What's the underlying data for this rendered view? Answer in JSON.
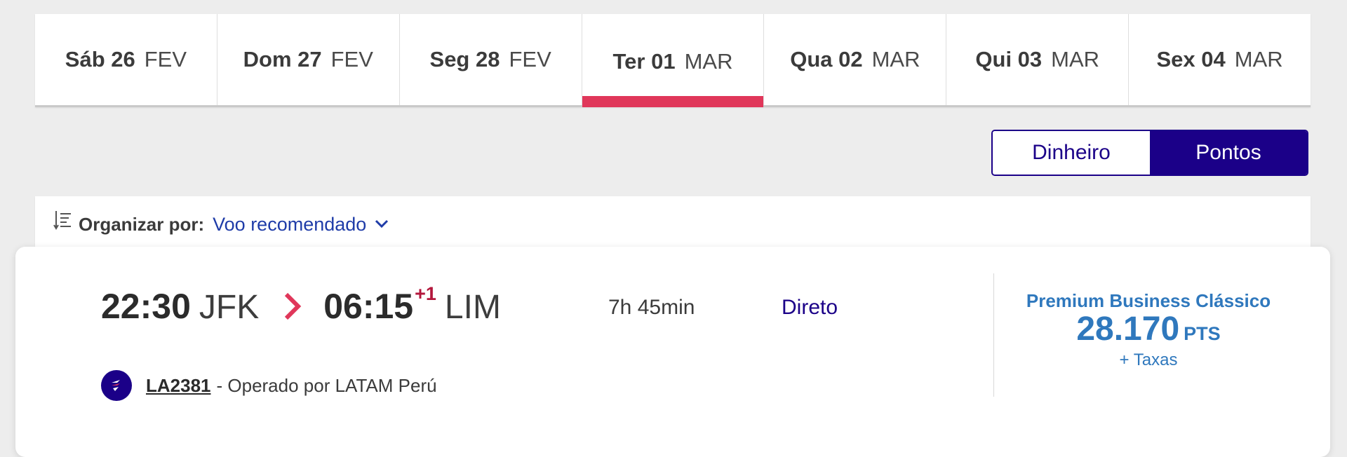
{
  "date_tabs": [
    {
      "day": "Sáb 26",
      "month": "FEV"
    },
    {
      "day": "Dom 27",
      "month": "FEV"
    },
    {
      "day": "Seg 28",
      "month": "FEV"
    },
    {
      "day": "Ter 01",
      "month": "MAR",
      "active": true
    },
    {
      "day": "Qua 02",
      "month": "MAR"
    },
    {
      "day": "Qui 03",
      "month": "MAR"
    },
    {
      "day": "Sex 04",
      "month": "MAR"
    }
  ],
  "toggle": {
    "money_label": "Dinheiro",
    "points_label": "Pontos",
    "selected": "Pontos"
  },
  "sort": {
    "label": "Organizar por:",
    "value": "Voo recomendado",
    "icon": "sort-icon"
  },
  "flight": {
    "departure_time": "22:30",
    "departure_airport": "JFK",
    "arrival_time": "06:15",
    "day_offset": "+1",
    "arrival_airport": "LIM",
    "duration": "7h 45min",
    "stops": "Direto",
    "flight_number": "LA2381",
    "operated_by": "- Operado por LATAM Perú",
    "fare": {
      "name": "Premium Business Clássico",
      "amount": "28.170",
      "unit": "PTS",
      "taxes": "+ Taxas"
    }
  },
  "colors": {
    "accent_red": "#e0375a",
    "brand_indigo": "#1b0088",
    "link_blue": "#1f3ca8",
    "fare_blue": "#2f78bd",
    "background": "#ededed"
  }
}
